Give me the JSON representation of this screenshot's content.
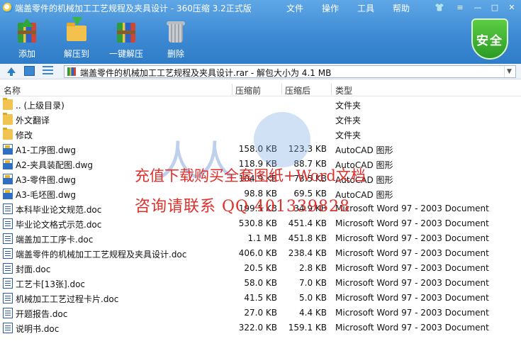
{
  "window": {
    "title": "端盖零件的机械加工工艺规程及夹具设计 - 360压缩 3.2正式版"
  },
  "menu": [
    "文件",
    "操作",
    "工具",
    "帮助"
  ],
  "toolbar": {
    "add": "添加",
    "extract": "解压到",
    "one_click": "一键解压",
    "delete": "删除"
  },
  "security_badge": "安全",
  "address": {
    "path": "端盖零件的机械加工工艺规程及夹具设计.rar - 解包大小为 4.1 MB"
  },
  "columns": {
    "name": "名称",
    "compressed_before": "压缩前",
    "compressed_after": "压缩后",
    "type": "类型"
  },
  "files": [
    {
      "name": ".. (上级目录)",
      "before": "",
      "after": "",
      "type": "文件夹",
      "icon": "folder"
    },
    {
      "name": "外文翻译",
      "before": "",
      "after": "",
      "type": "文件夹",
      "icon": "folder"
    },
    {
      "name": "修改",
      "before": "",
      "after": "",
      "type": "文件夹",
      "icon": "folder"
    },
    {
      "name": "A1-工序图.dwg",
      "before": "158.0 KB",
      "after": "123.3 KB",
      "type": "AutoCAD 图形",
      "icon": "dwg"
    },
    {
      "name": "A2-夹具装配图.dwg",
      "before": "118.9 KB",
      "after": "88.7 KB",
      "type": "AutoCAD 图形",
      "icon": "dwg"
    },
    {
      "name": "A3-零件图.dwg",
      "before": "104.9 KB",
      "after": "73.5 KB",
      "type": "AutoCAD 图形",
      "icon": "dwg"
    },
    {
      "name": "A3-毛坯图.dwg",
      "before": "98.8 KB",
      "after": "69.5 KB",
      "type": "AutoCAD 图形",
      "icon": "dwg"
    },
    {
      "name": "本科毕业论文规范.doc",
      "before": "199.5 KB",
      "after": "34.9 KB",
      "type": "Microsoft Word 97 - 2003 Document",
      "icon": "doc"
    },
    {
      "name": "毕业论文格式示范.doc",
      "before": "530.8 KB",
      "after": "451.4 KB",
      "type": "Microsoft Word 97 - 2003 Document",
      "icon": "doc"
    },
    {
      "name": "端盖加工工序卡.doc",
      "before": "1.1 MB",
      "after": "451.8 KB",
      "type": "Microsoft Word 97 - 2003 Document",
      "icon": "doc"
    },
    {
      "name": "端盖零件的机械加工工艺规程及夹具设计.doc",
      "before": "406.0 KB",
      "after": "238.4 KB",
      "type": "Microsoft Word 97 - 2003 Document",
      "icon": "doc"
    },
    {
      "name": "封面.doc",
      "before": "20.5 KB",
      "after": "2.8 KB",
      "type": "Microsoft Word 97 - 2003 Document",
      "icon": "doc"
    },
    {
      "name": "工艺卡[13张].doc",
      "before": "58.0 KB",
      "after": "7.0 KB",
      "type": "Microsoft Word 97 - 2003 Document",
      "icon": "doc"
    },
    {
      "name": "机械加工工艺过程卡片.doc",
      "before": "41.5 KB",
      "after": "5.0 KB",
      "type": "Microsoft Word 97 - 2003 Document",
      "icon": "doc"
    },
    {
      "name": "开题报告.doc",
      "before": "27.0 KB",
      "after": "4.4 KB",
      "type": "Microsoft Word 97 - 2003 Document",
      "icon": "doc"
    },
    {
      "name": "说明书.doc",
      "before": "322.0 KB",
      "after": "159.1 KB",
      "type": "Microsoft Word 97 - 2003 Document",
      "icon": "doc"
    }
  ],
  "watermark": {
    "line1": "充值下载购买全套图纸+Word文档",
    "line2": "咨询请联系 QQ 401339828"
  }
}
